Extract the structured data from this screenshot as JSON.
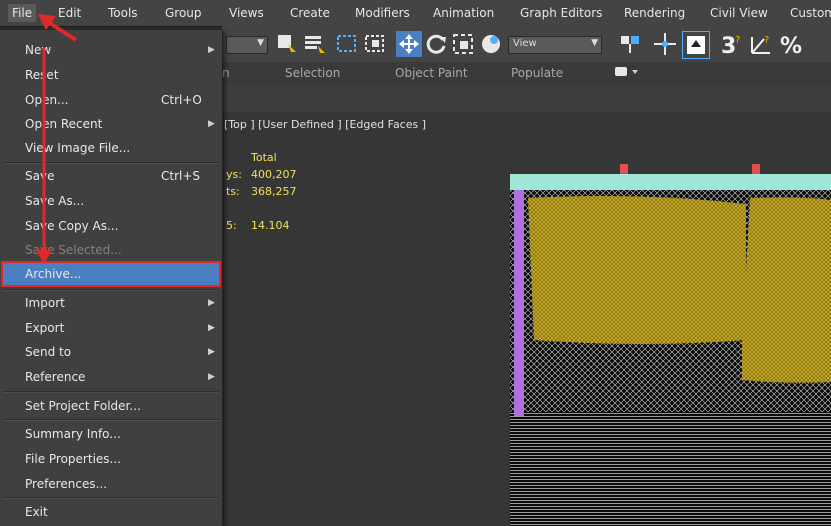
{
  "menubar": {
    "items": [
      "File",
      "Edit",
      "Tools",
      "Group",
      "Views",
      "Create",
      "Modifiers",
      "Animation",
      "Graph Editors",
      "Rendering",
      "Civil View",
      "Custom"
    ]
  },
  "toolbar": {
    "view_dropdown": "View"
  },
  "ribbon": {
    "tabs": [
      "n",
      "Selection",
      "Object Paint",
      "Populate"
    ]
  },
  "viewport": {
    "label": "[Top ] [User Defined ] [Edged Faces ]",
    "stats": {
      "total_label": "Total",
      "polys_label": "ys:",
      "polys_value": "400,207",
      "verts_label": "ts:",
      "verts_value": "368,257",
      "fps_label": "5:",
      "fps_value": "14.104"
    }
  },
  "file_menu": {
    "items": [
      {
        "label": "New",
        "shortcut": "",
        "submenu": true
      },
      {
        "label": "Reset",
        "shortcut": "",
        "submenu": false
      },
      {
        "label": "Open...",
        "shortcut": "Ctrl+O",
        "submenu": false
      },
      {
        "label": "Open Recent",
        "shortcut": "",
        "submenu": true
      },
      {
        "label": "View Image File...",
        "shortcut": "",
        "submenu": false
      },
      {
        "label": "Save",
        "shortcut": "Ctrl+S",
        "submenu": false
      },
      {
        "label": "Save As...",
        "shortcut": "",
        "submenu": false
      },
      {
        "label": "Save Copy As...",
        "shortcut": "",
        "submenu": false
      },
      {
        "label": "Save Selected...",
        "shortcut": "",
        "submenu": false
      },
      {
        "label": "Archive...",
        "shortcut": "",
        "submenu": false
      },
      {
        "label": "Import",
        "shortcut": "",
        "submenu": true
      },
      {
        "label": "Export",
        "shortcut": "",
        "submenu": true
      },
      {
        "label": "Send to",
        "shortcut": "",
        "submenu": true
      },
      {
        "label": "Reference",
        "shortcut": "",
        "submenu": true
      },
      {
        "label": "Set Project Folder...",
        "shortcut": "",
        "submenu": false
      },
      {
        "label": "Summary Info...",
        "shortcut": "",
        "submenu": false
      },
      {
        "label": "File Properties...",
        "shortcut": "",
        "submenu": false
      },
      {
        "label": "Preferences...",
        "shortcut": "",
        "submenu": false
      },
      {
        "label": "Exit",
        "shortcut": "",
        "submenu": false
      }
    ]
  },
  "colors": {
    "highlight": "#4a7fc1",
    "annotation": "#e02828",
    "stats_text": "#f2e05a",
    "mesh_yellow": "#b59a1a",
    "mesh_cyan": "#9ee6d8"
  }
}
